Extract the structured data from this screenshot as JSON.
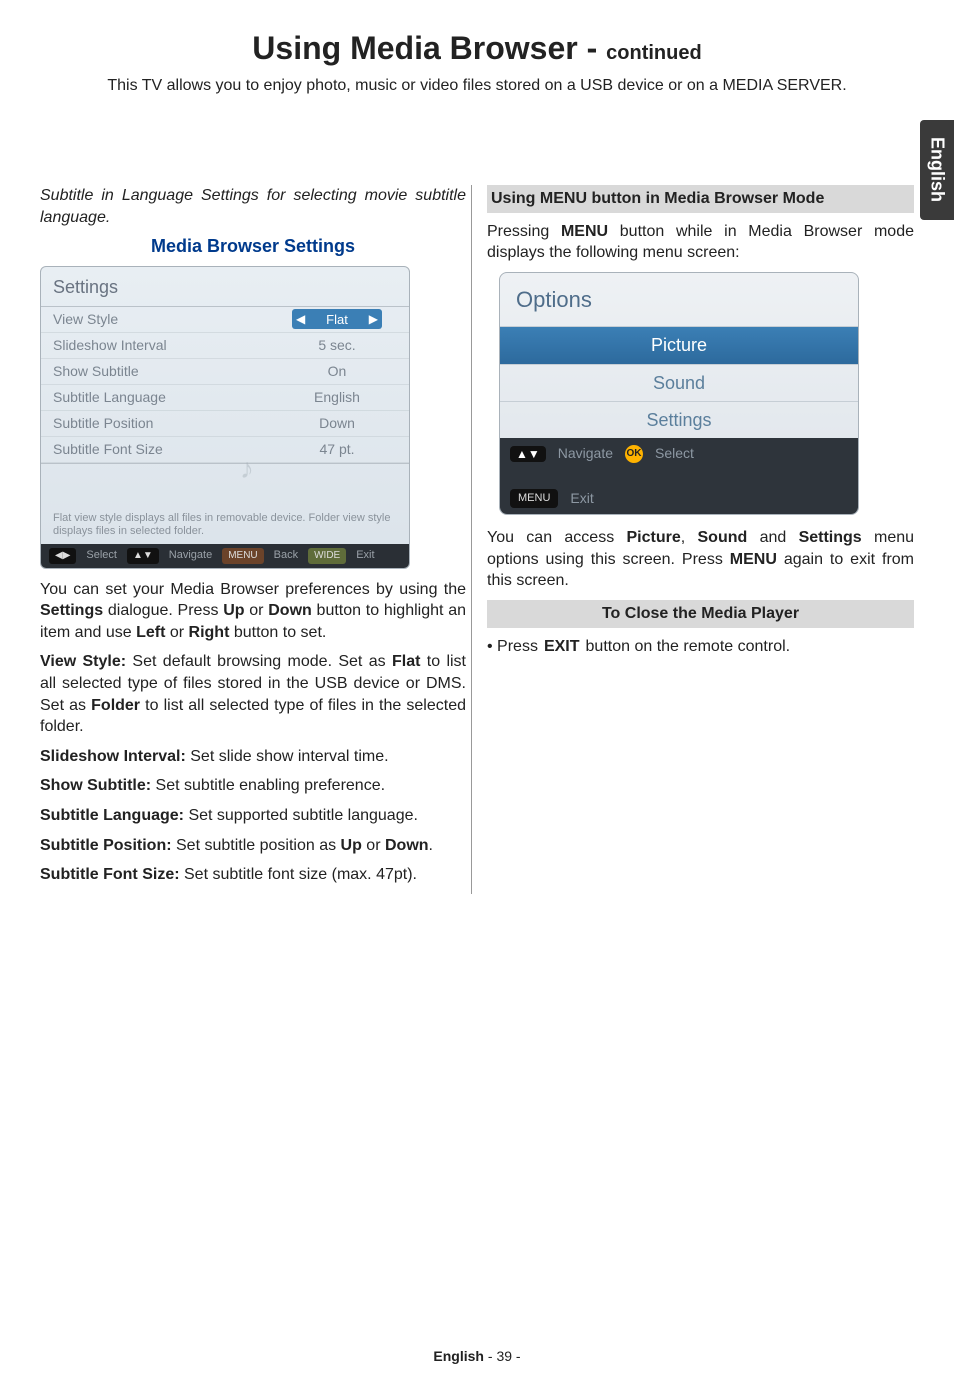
{
  "side_tab": "English",
  "title_main": "Using Media Browser - ",
  "title_cont": "continued",
  "intro": "This TV allows you to enjoy photo, music or video files stored on a USB device or on a MEDIA SERVER.",
  "left": {
    "note": "Subtitle in Language Settings for selecting movie subtitle language.",
    "heading": "Media Browser Settings",
    "settings": {
      "title": "Settings",
      "rows": [
        {
          "label": "View Style",
          "value": "Flat",
          "selected": true
        },
        {
          "label": "Slideshow Interval",
          "value": "5 sec."
        },
        {
          "label": "Show Subtitle",
          "value": "On"
        },
        {
          "label": "Subtitle Language",
          "value": "English"
        },
        {
          "label": "Subtitle Position",
          "value": "Down"
        },
        {
          "label": "Subtitle Font Size",
          "value": "47 pt."
        }
      ],
      "help": "Flat view style displays all files in removable device. Folder view style displays files in selected folder.",
      "footer": {
        "k1": "◀▶",
        "l1": "Select",
        "k2": "▲▼",
        "l2": "Navigate",
        "k3": "MENU",
        "l3": "Back",
        "k4": "WIDE",
        "l4": "Exit"
      }
    },
    "p1_a": "You can set your Media Browser preferences by using the ",
    "p1_b": "Settings",
    "p1_c": " dialogue. Press ",
    "p1_d": "Up",
    "p1_e": " or ",
    "p1_f": "Down",
    "p1_g": " button to highlight an item and use ",
    "p1_h": "Left",
    "p1_i": " or ",
    "p1_j": "Right",
    "p1_k": " button to set.",
    "p2_a": "View Style:",
    "p2_b": " Set default browsing mode. Set as ",
    "p2_c": "Flat",
    "p2_d": " to list all selected type of files stored in the USB device or DMS. Set as ",
    "p2_e": "Folder",
    "p2_f": " to list all selected type of files in the selected folder.",
    "p3_a": "Slideshow Interval:",
    "p3_b": " Set slide show interval time.",
    "p4_a": "Show Subtitle:",
    "p4_b": " Set subtitle enabling preference.",
    "p5_a": "Subtitle Language:",
    "p5_b": " Set supported subtitle language.",
    "p6_a": "Subtitle Position:",
    "p6_b": " Set subtitle position as ",
    "p6_c": "Up",
    "p6_d": " or ",
    "p6_e": "Down",
    "p6_f": ".",
    "p7_a": "Subtitle Font Size:",
    "p7_b": " Set subtitle font size (max. 47pt)."
  },
  "right": {
    "heading_bg": "Using MENU button in Media Browser Mode",
    "p1_a": "Pressing ",
    "p1_b": "MENU",
    "p1_c": " button while in Media Browser mode displays the following menu screen:",
    "options": {
      "title": "Options",
      "items": [
        "Picture",
        "Sound",
        "Settings"
      ],
      "footer": {
        "nav_icon": "▲▼",
        "nav": "Navigate",
        "ok_icon": "OK",
        "ok": "Select",
        "menu_icon": "MENU",
        "menu": "Exit"
      }
    },
    "p2_a": "You can access ",
    "p2_b": "Picture",
    "p2_c": ", ",
    "p2_d": "Sound",
    "p2_e": " and ",
    "p2_f": "Settings",
    "p2_g": " menu options using this screen. Press ",
    "p2_h": "MENU",
    "p2_i": " again to exit from this screen.",
    "heading_close": "To Close the Media Player",
    "close_a": "• Press ",
    "close_b": "EXIT",
    "close_c": " button on the remote control."
  },
  "footer": {
    "lang": "English",
    "sep": "  - ",
    "page": "39",
    "sep2": " -"
  }
}
